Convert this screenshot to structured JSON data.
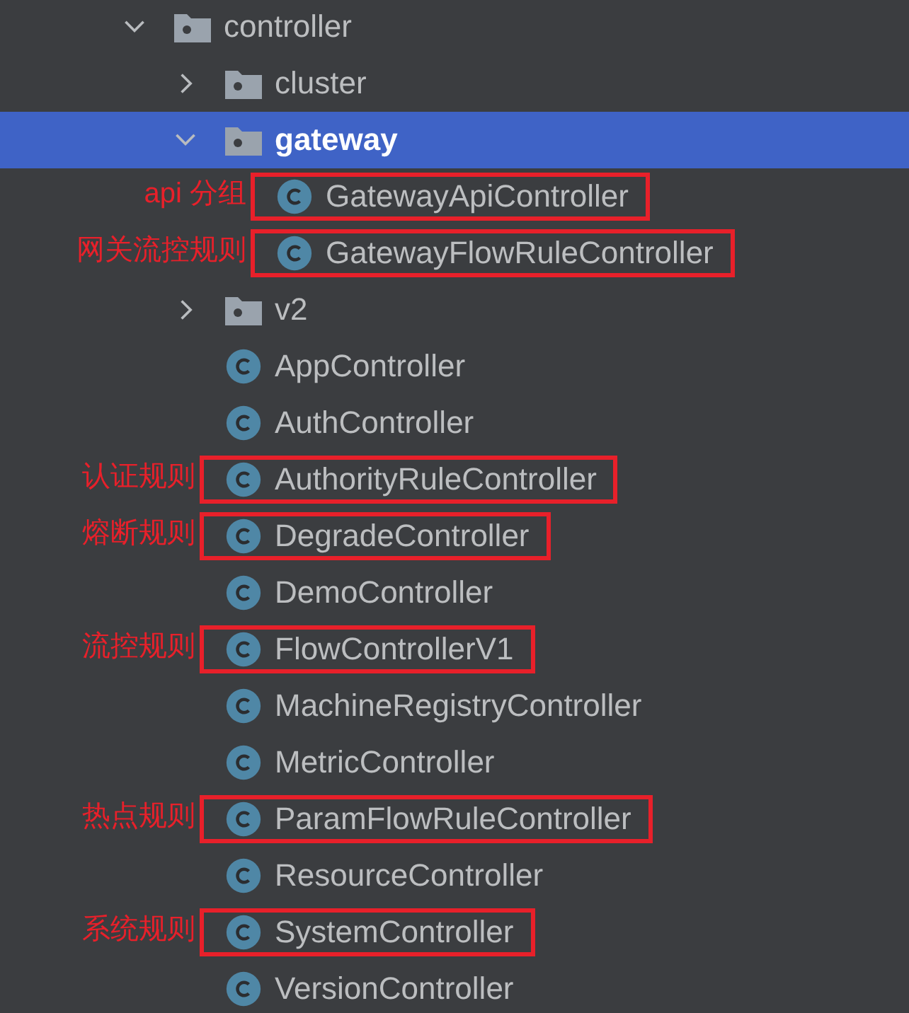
{
  "tree": [
    {
      "name": "controller",
      "kind": "folder",
      "expanded": true,
      "selected": false,
      "children": [
        {
          "name": "cluster",
          "kind": "folder",
          "expanded": false,
          "selected": false
        },
        {
          "name": "gateway",
          "kind": "folder",
          "expanded": true,
          "selected": true,
          "children": [
            {
              "name": "GatewayApiController",
              "kind": "class",
              "selected": false,
              "highlighted": true,
              "note": "api 分组"
            },
            {
              "name": "GatewayFlowRuleController",
              "kind": "class",
              "selected": false,
              "highlighted": true,
              "note": "网关流控规则"
            }
          ]
        },
        {
          "name": "v2",
          "kind": "folder",
          "expanded": false,
          "selected": false
        },
        {
          "name": "AppController",
          "kind": "class",
          "selected": false
        },
        {
          "name": "AuthController",
          "kind": "class",
          "selected": false
        },
        {
          "name": "AuthorityRuleController",
          "kind": "class",
          "selected": false,
          "highlighted": true,
          "note": "认证规则"
        },
        {
          "name": "DegradeController",
          "kind": "class",
          "selected": false,
          "highlighted": true,
          "note": "熔断规则"
        },
        {
          "name": "DemoController",
          "kind": "class",
          "selected": false
        },
        {
          "name": "FlowControllerV1",
          "kind": "class",
          "selected": false,
          "highlighted": true,
          "note": "流控规则"
        },
        {
          "name": "MachineRegistryController",
          "kind": "class",
          "selected": false
        },
        {
          "name": "MetricController",
          "kind": "class",
          "selected": false
        },
        {
          "name": "ParamFlowRuleController",
          "kind": "class",
          "selected": false,
          "highlighted": true,
          "note": "热点规则"
        },
        {
          "name": "ResourceController",
          "kind": "class",
          "selected": false
        },
        {
          "name": "SystemController",
          "kind": "class",
          "selected": false,
          "highlighted": true,
          "note": "系统规则"
        },
        {
          "name": "VersionController",
          "kind": "class",
          "selected": false
        }
      ]
    }
  ]
}
